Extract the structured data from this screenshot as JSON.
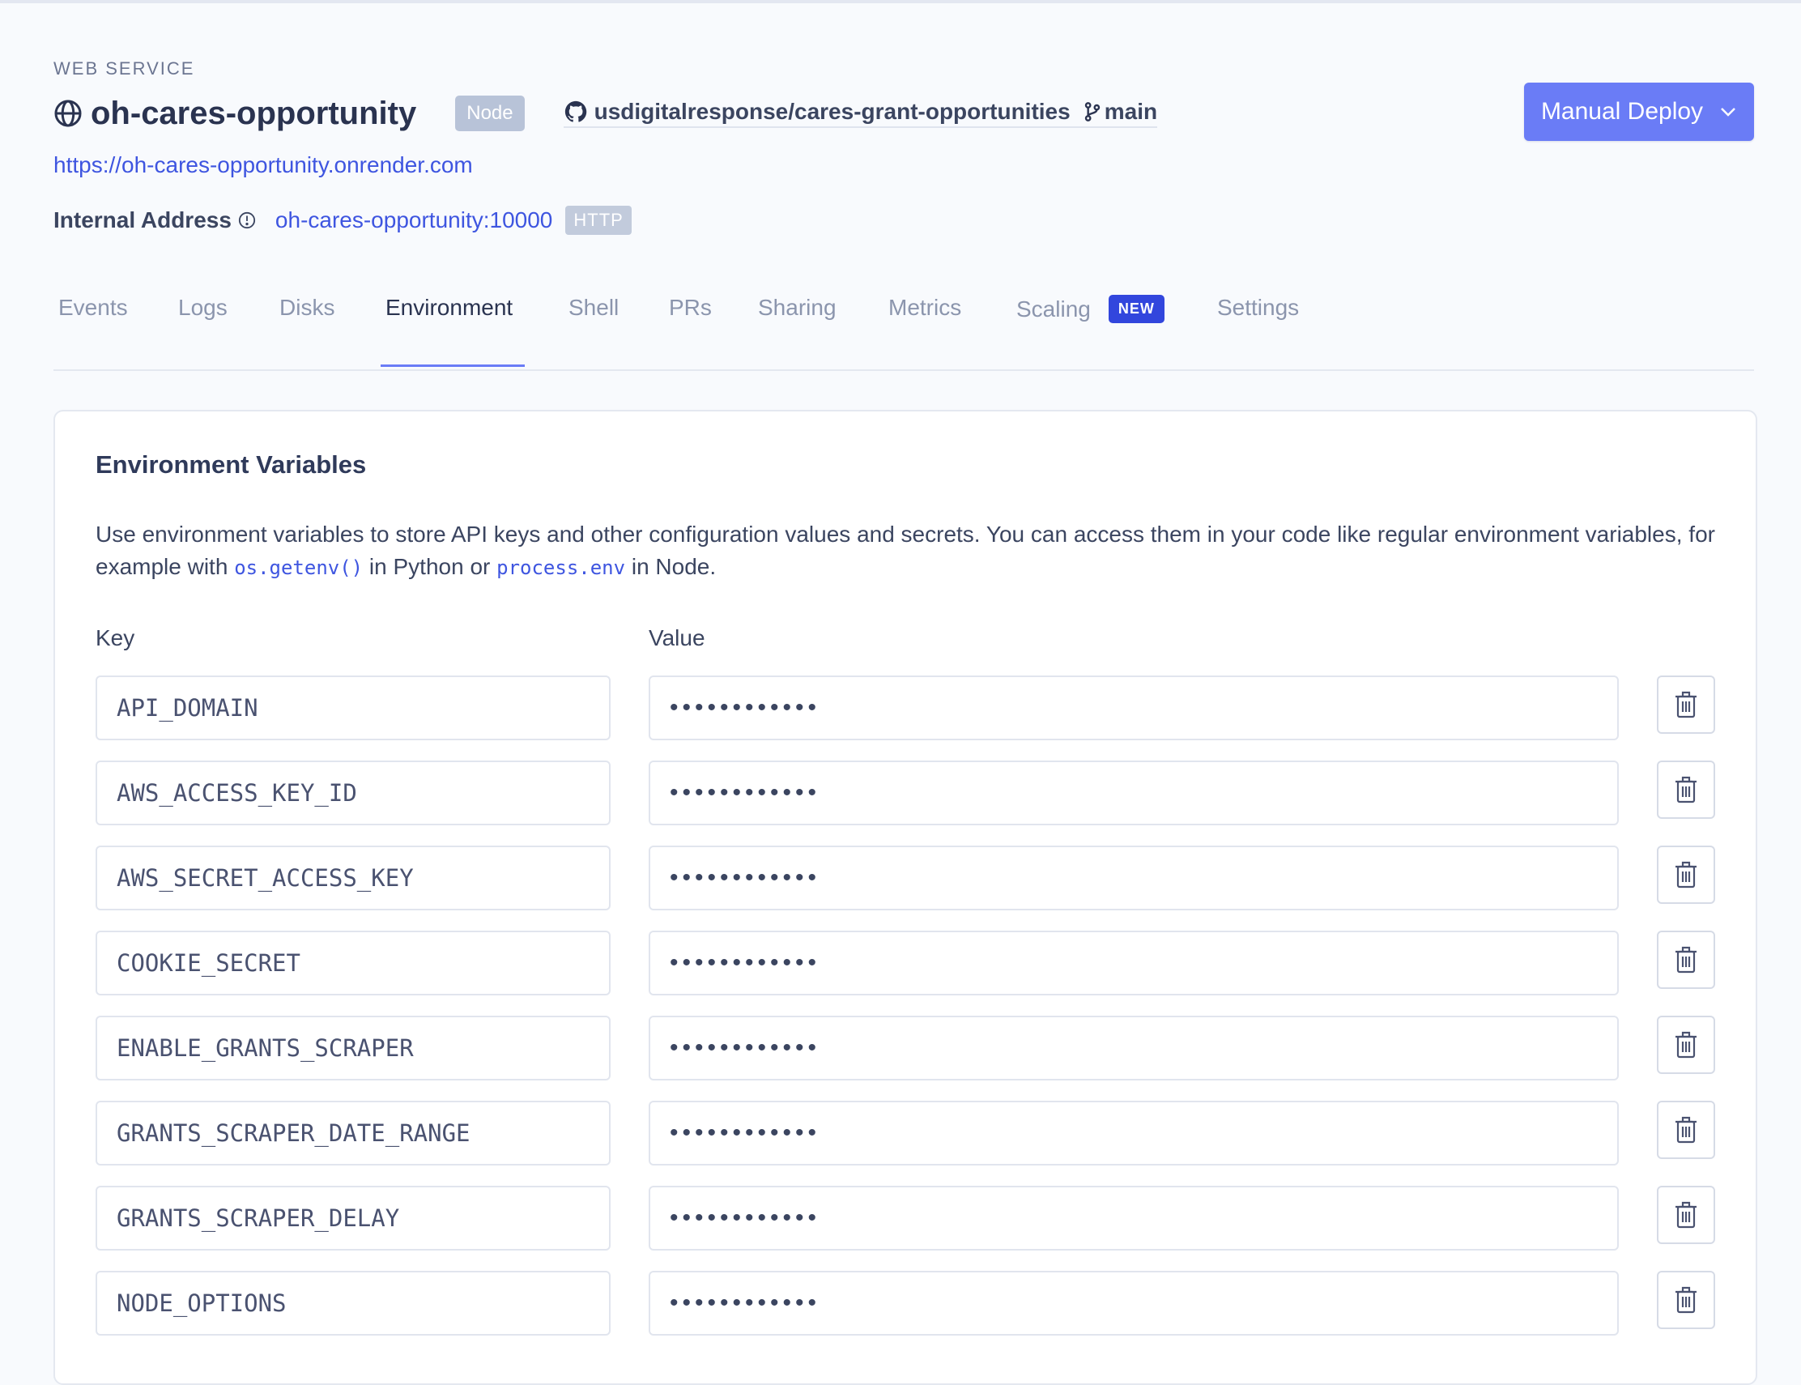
{
  "header": {
    "service_type": "WEB SERVICE",
    "service_name": "oh-cares-opportunity",
    "runtime": "Node",
    "repo": "usdigitalresponse/cares-grant-opportunities",
    "branch": "main",
    "deploy_label": "Manual Deploy",
    "url": "https://oh-cares-opportunity.onrender.com",
    "internal_label": "Internal Address",
    "internal_address": "oh-cares-opportunity:10000",
    "internal_protocol": "HTTP"
  },
  "tabs": [
    {
      "label": "Events"
    },
    {
      "label": "Logs"
    },
    {
      "label": "Disks"
    },
    {
      "label": "Environment",
      "active": true
    },
    {
      "label": "Shell"
    },
    {
      "label": "PRs"
    },
    {
      "label": "Sharing"
    },
    {
      "label": "Metrics"
    },
    {
      "label": "Scaling",
      "badge": "NEW"
    },
    {
      "label": "Settings"
    }
  ],
  "env": {
    "title": "Environment Variables",
    "desc_part1": "Use environment variables to store API keys and other configuration values and secrets. You can access them in your code like regular environment variables, for example with ",
    "code1": "os.getenv()",
    "desc_part2": " in Python or ",
    "code2": "process.env",
    "desc_part3": " in Node.",
    "key_header": "Key",
    "value_header": "Value",
    "rows": [
      {
        "key": "API_DOMAIN",
        "value": "••••••••••••"
      },
      {
        "key": "AWS_ACCESS_KEY_ID",
        "value": "••••••••••••"
      },
      {
        "key": "AWS_SECRET_ACCESS_KEY",
        "value": "••••••••••••"
      },
      {
        "key": "COOKIE_SECRET",
        "value": "••••••••••••"
      },
      {
        "key": "ENABLE_GRANTS_SCRAPER",
        "value": "••••••••••••"
      },
      {
        "key": "GRANTS_SCRAPER_DATE_RANGE",
        "value": "••••••••••••"
      },
      {
        "key": "GRANTS_SCRAPER_DELAY",
        "value": "••••••••••••"
      },
      {
        "key": "NODE_OPTIONS",
        "value": "••••••••••••"
      }
    ]
  },
  "colors": {
    "accent": "#6a7cf6",
    "link": "#3e55e0",
    "new_badge": "#3246dd"
  }
}
